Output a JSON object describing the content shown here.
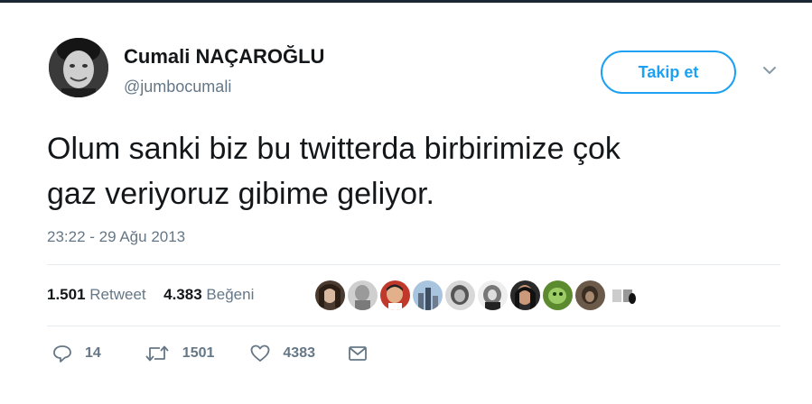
{
  "user": {
    "name": "Cumali NAÇAROĞLU",
    "handle": "@jumbocumali"
  },
  "follow_label": "Takip et",
  "tweet": {
    "lines": [
      "Olum sanki biz bu twitterda birbirimize çok",
      "gaz veriyoruz gibime geliyor."
    ],
    "timestamp": "23:22 - 29 Ağu 2013"
  },
  "stats": {
    "retweets": "1.501",
    "retweets_label": "Retweet",
    "likes": "4.383",
    "likes_label": "Beğeni"
  },
  "actions": {
    "reply_count": "14",
    "retweet_count": "1501",
    "like_count": "4383"
  },
  "colors": {
    "accent": "#1da1f2",
    "secondary_text": "#657786",
    "primary_text": "#14171a",
    "divider": "#e6ecf0"
  },
  "icons": {
    "reply": "reply-icon",
    "retweet": "retweet-icon",
    "like": "heart-icon",
    "dm": "envelope-icon",
    "more": "chevron-down-icon"
  }
}
